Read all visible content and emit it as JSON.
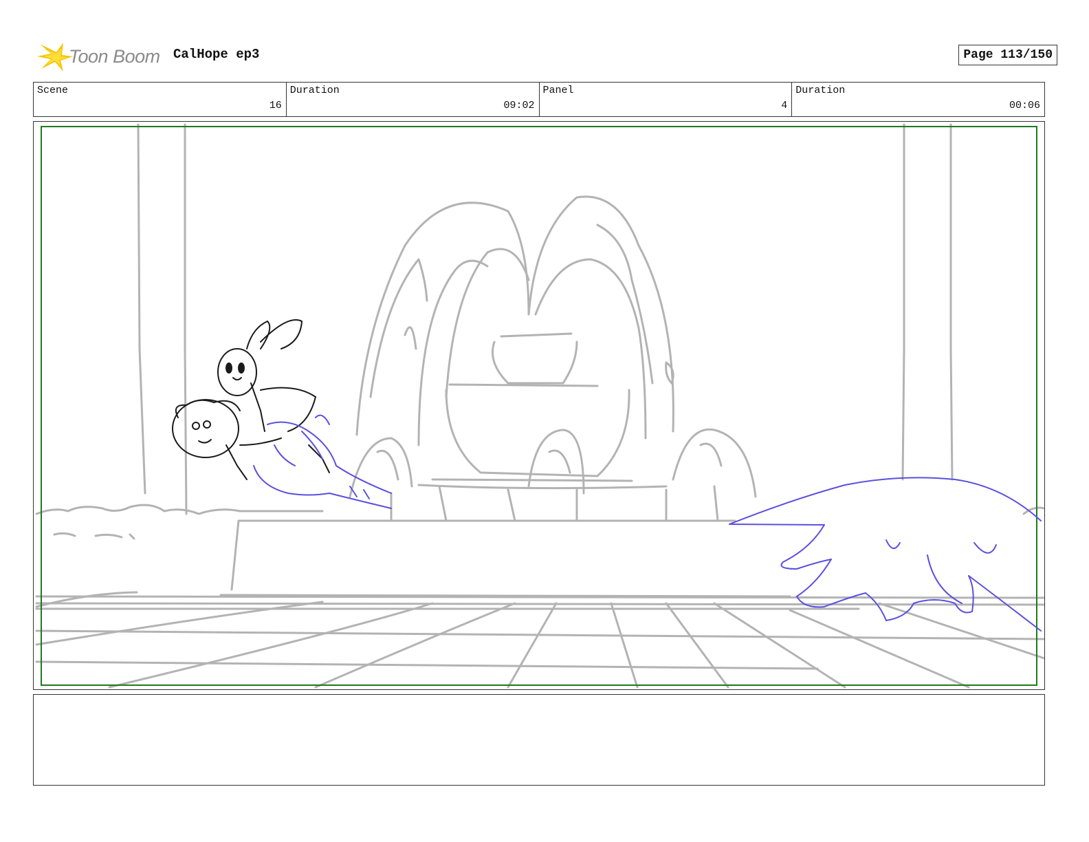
{
  "header": {
    "logo_text": "Toon Boom",
    "project_title": "CalHope ep3",
    "page_label": "Page 113/150"
  },
  "info": [
    {
      "label": "Scene",
      "value": "16"
    },
    {
      "label": "Duration",
      "value": "09:02"
    },
    {
      "label": "Panel",
      "value": "4"
    },
    {
      "label": "Duration",
      "value": "00:06"
    }
  ],
  "colors": {
    "sketch_gray": "#b3b3b3",
    "character_ink": "#1a1a1a",
    "effect_blue": "#5a4fe0",
    "safe_frame_green": "#1e7a1e",
    "logo_yellow": "#f5c400"
  },
  "icons": [
    "toon-boom-logo-icon"
  ]
}
